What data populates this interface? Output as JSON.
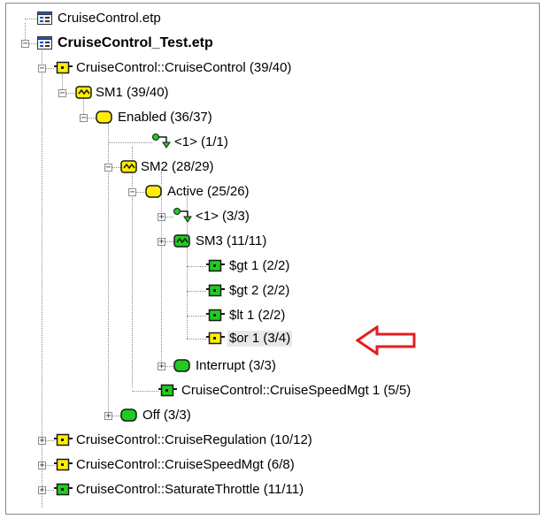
{
  "tree": {
    "items": [
      {
        "label": "CruiseControl.etp",
        "icon": "file-grid-icon"
      },
      {
        "label": "CruiseControl_Test.etp",
        "icon": "file-grid-icon",
        "expander": "minus"
      },
      {
        "label": "CruiseControl::CruiseControl (39/40)",
        "icon": "yellow-operator-icon",
        "expander": "minus"
      },
      {
        "label": "SM1 (39/40)",
        "icon": "yellow-statemachine-icon",
        "expander": "minus"
      },
      {
        "label": "Enabled (36/37)",
        "icon": "yellow-state-icon",
        "expander": "minus"
      },
      {
        "label": "<1> (1/1)",
        "icon": "green-transition-icon"
      },
      {
        "label": "SM2 (28/29)",
        "icon": "yellow-statemachine-icon",
        "expander": "minus"
      },
      {
        "label": "Active (25/26)",
        "icon": "yellow-state-icon",
        "expander": "minus"
      },
      {
        "label": "<1> (3/3)",
        "icon": "green-transition-icon",
        "expander": "plus"
      },
      {
        "label": "SM3 (11/11)",
        "icon": "green-statemachine-icon",
        "expander": "plus"
      },
      {
        "label": "$gt 1 (2/2)",
        "icon": "green-operator-icon"
      },
      {
        "label": "$gt 2 (2/2)",
        "icon": "green-operator-icon"
      },
      {
        "label": "$lt 1 (2/2)",
        "icon": "green-operator-icon"
      },
      {
        "label": "$or 1 (3/4)",
        "icon": "yellow-operator-icon",
        "selected": true
      },
      {
        "label": "Interrupt (3/3)",
        "icon": "green-state-icon",
        "expander": "plus"
      },
      {
        "label": "CruiseControl::CruiseSpeedMgt 1 (5/5)",
        "icon": "green-operator-icon"
      },
      {
        "label": "Off (3/3)",
        "icon": "green-state-icon",
        "expander": "plus"
      },
      {
        "label": "CruiseControl::CruiseRegulation (10/12)",
        "icon": "yellow-operator-icon",
        "expander": "plus"
      },
      {
        "label": "CruiseControl::CruiseSpeedMgt (6/8)",
        "icon": "yellow-operator-icon",
        "expander": "plus"
      },
      {
        "label": "CruiseControl::SaturateThrottle (11/11)",
        "icon": "green-operator-icon",
        "expander": "plus"
      }
    ]
  },
  "annotation": {
    "icon": "red-arrow-left-icon",
    "color": "#e02020"
  },
  "colors": {
    "yellow": "#ffee00",
    "green": "#1fcc1f",
    "dark": "#1a1a1a"
  }
}
